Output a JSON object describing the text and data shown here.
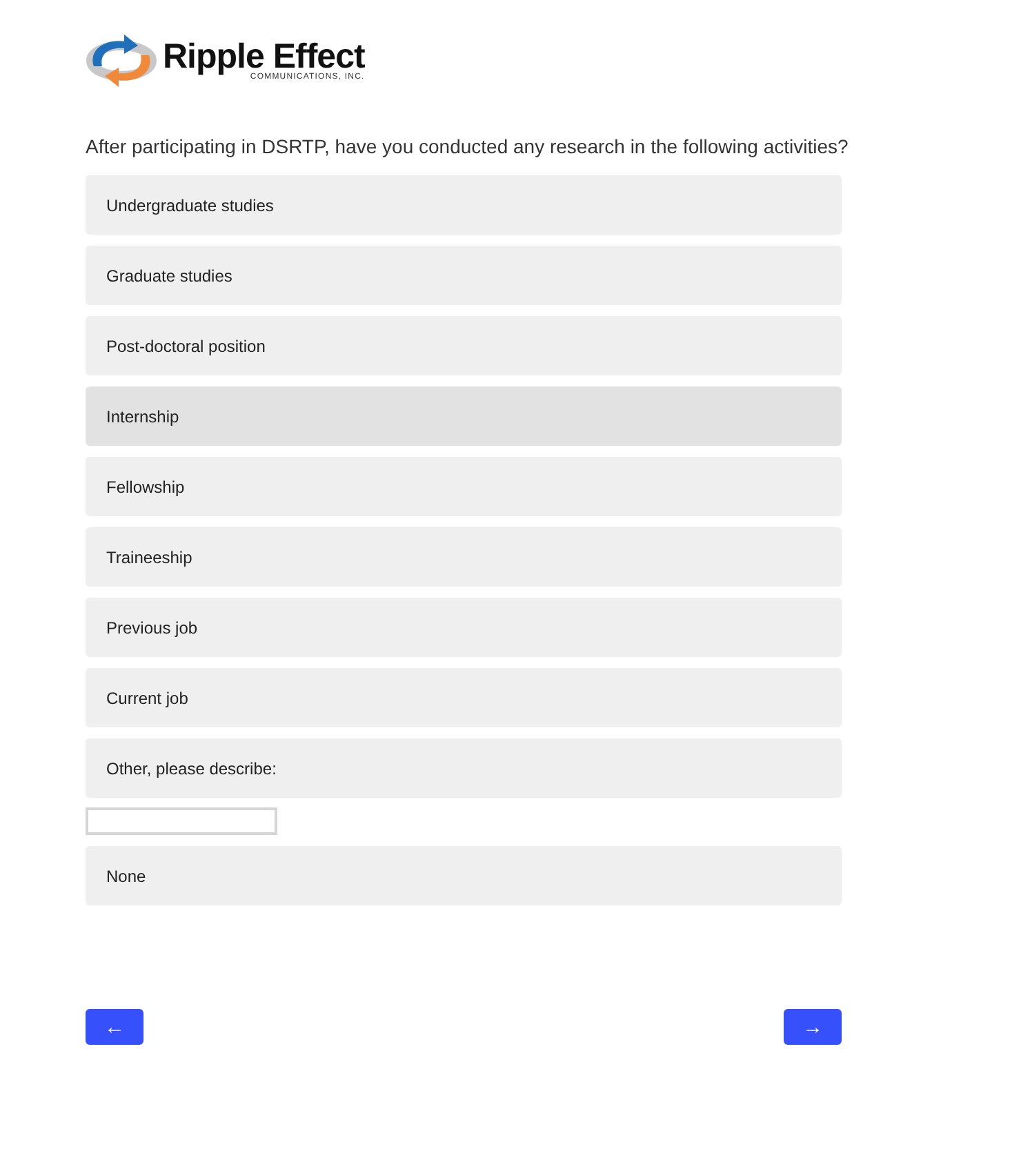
{
  "logo": {
    "name": "Ripple Effect",
    "tagline": "COMMUNICATIONS, INC."
  },
  "question": "After participating in DSRTP, have you conducted any research in the following activities?",
  "options": [
    {
      "label": "Undergraduate studies",
      "kind": "choice",
      "hovered": false
    },
    {
      "label": "Graduate studies",
      "kind": "choice",
      "hovered": false
    },
    {
      "label": "Post-doctoral position",
      "kind": "choice",
      "hovered": false
    },
    {
      "label": "Internship",
      "kind": "choice",
      "hovered": true
    },
    {
      "label": "Fellowship",
      "kind": "choice",
      "hovered": false
    },
    {
      "label": "Traineeship",
      "kind": "choice",
      "hovered": false
    },
    {
      "label": "Previous job",
      "kind": "choice",
      "hovered": false
    },
    {
      "label": "Current job",
      "kind": "choice",
      "hovered": false
    },
    {
      "label": "Other, please describe:",
      "kind": "other",
      "hovered": false
    },
    {
      "label": "None",
      "kind": "choice",
      "hovered": false
    }
  ],
  "nav": {
    "back": "←",
    "next": "→"
  }
}
